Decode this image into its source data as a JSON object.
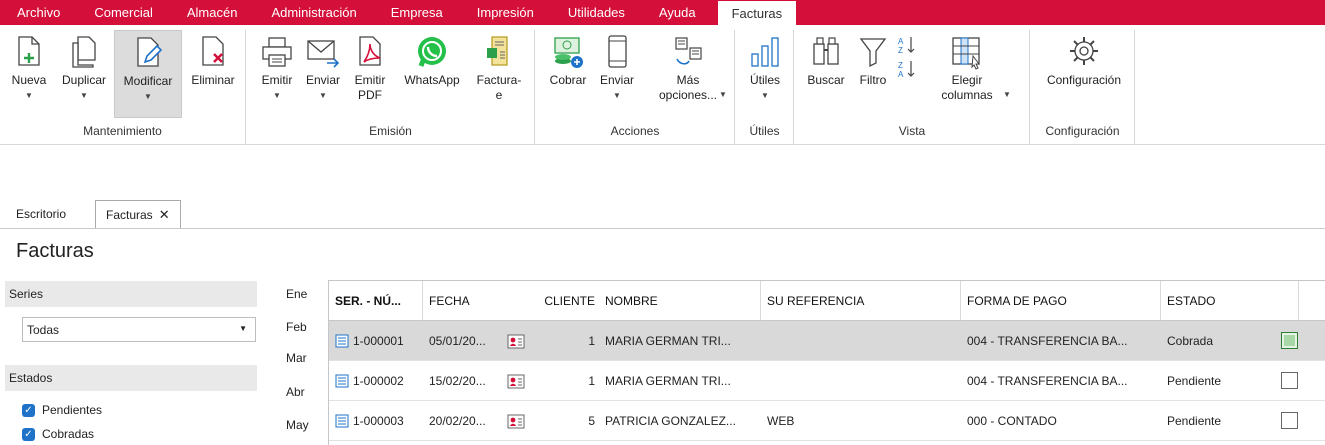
{
  "menubar": {
    "items": [
      "Archivo",
      "Comercial",
      "Almacén",
      "Administración",
      "Empresa",
      "Impresión",
      "Utilidades",
      "Ayuda"
    ],
    "active": "Facturas"
  },
  "ribbon": {
    "mantenimiento": {
      "label": "Mantenimiento",
      "nueva": "Nueva",
      "duplicar": "Duplicar",
      "modificar": "Modificar",
      "eliminar": "Eliminar"
    },
    "emision": {
      "label": "Emisión",
      "emitir": "Emitir",
      "enviar": "Enviar",
      "emitir_pdf": "Emitir PDF",
      "whatsapp": "WhatsApp",
      "facturae": "Factura-e"
    },
    "acciones": {
      "label": "Acciones",
      "cobrar": "Cobrar",
      "enviar": "Enviar",
      "mas_opciones": "Más opciones..."
    },
    "utiles": {
      "label": "Útiles",
      "utiles": "Útiles"
    },
    "vista": {
      "label": "Vista",
      "buscar": "Buscar",
      "filtro": "Filtro",
      "elegir_columnas": "Elegir columnas"
    },
    "configuracion": {
      "label": "Configuración",
      "configuracion": "Configuración"
    }
  },
  "tabs": {
    "escritorio": "Escritorio",
    "facturas": "Facturas",
    "close": "✕"
  },
  "page_title": "Facturas",
  "filters": {
    "series_label": "Series",
    "series_value": "Todas",
    "estados_label": "Estados",
    "estados": [
      "Pendientes",
      "Cobradas"
    ]
  },
  "months": [
    "Ene",
    "Feb",
    "Mar",
    "Abr",
    "May"
  ],
  "grid": {
    "columns": [
      "SER. - NÚ...",
      "FECHA",
      "CLIENTE",
      "NOMBRE",
      "SU REFERENCIA",
      "FORMA DE PAGO",
      "ESTADO"
    ],
    "rows": [
      {
        "numero": "1-000001",
        "fecha": "05/01/20...",
        "cliente": "1",
        "nombre": "MARIA GERMAN TRI...",
        "referencia": "",
        "forma_pago": "004 - TRANSFERENCIA BA...",
        "estado": "Cobrada",
        "checked": true
      },
      {
        "numero": "1-000002",
        "fecha": "15/02/20...",
        "cliente": "1",
        "nombre": "MARIA GERMAN TRI...",
        "referencia": "",
        "forma_pago": "004 - TRANSFERENCIA BA...",
        "estado": "Pendiente",
        "checked": false
      },
      {
        "numero": "1-000003",
        "fecha": "20/02/20...",
        "cliente": "5",
        "nombre": "PATRICIA GONZALEZ...",
        "referencia": "WEB",
        "forma_pago": "000 - CONTADO",
        "estado": "Pendiente",
        "checked": false
      }
    ]
  },
  "colors": {
    "accent": "#d4103a",
    "selected_row": "#d9d9d9",
    "checkbox_blue": "#1e73c8"
  }
}
